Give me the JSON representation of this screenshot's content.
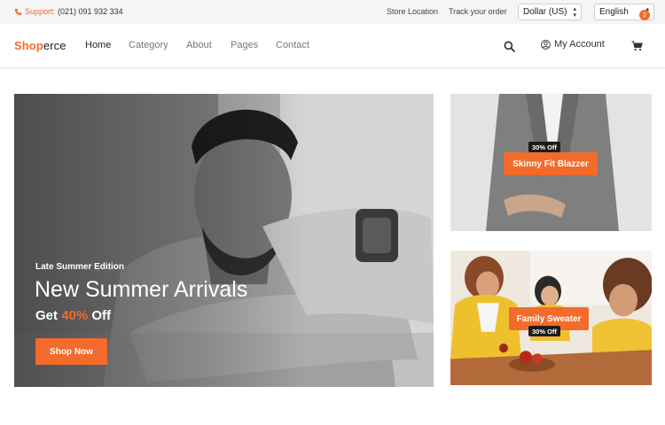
{
  "topbar": {
    "support_label": "Support:",
    "support_phone": "(021) 091 932 334",
    "links": [
      "Store Location",
      "Track your order"
    ],
    "currency": "Dollar (US)",
    "language": "English"
  },
  "header": {
    "logo_accent": "Shop",
    "logo_rest": "erce",
    "nav": [
      "Home",
      "Category",
      "About",
      "Pages",
      "Contact"
    ],
    "account_label": "My Account",
    "cart_count": "2",
    "search_icon": "search-icon",
    "user_icon": "user-circle-icon",
    "cart_icon": "shopping-cart-icon"
  },
  "hero": {
    "eyebrow": "Late Summer Edition",
    "title": "New Summer Arrivals",
    "sub_before": "Get ",
    "sub_highlight": "40%",
    "sub_after": " Off",
    "button": "Shop Now"
  },
  "promos": [
    {
      "badge": "30% Off",
      "label": "Skinny Fit Blazzer"
    },
    {
      "badge": "30% Off",
      "label": "Family Sweater"
    }
  ],
  "colors": {
    "accent": "#f26b2b",
    "badge_dark": "#1c1c1c",
    "topbar_bg": "#f5f5f5"
  }
}
